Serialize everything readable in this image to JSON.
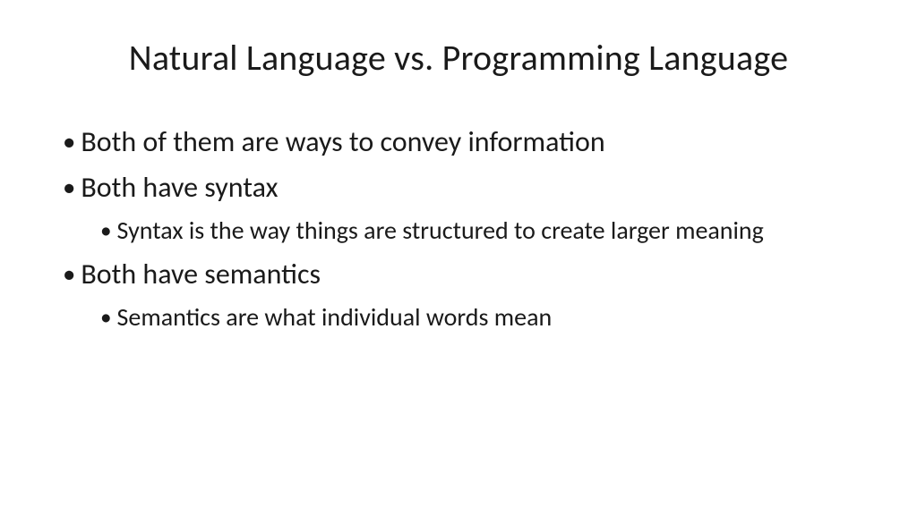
{
  "slide": {
    "title": "Natural Language vs. Programming Language",
    "bullets": {
      "b1": "Both of them are ways to convey information",
      "b2": "Both have syntax",
      "b2_1": "Syntax is the way things are structured to create larger meaning",
      "b3": "Both have semantics",
      "b3_1": "Semantics are what individual words mean"
    }
  }
}
